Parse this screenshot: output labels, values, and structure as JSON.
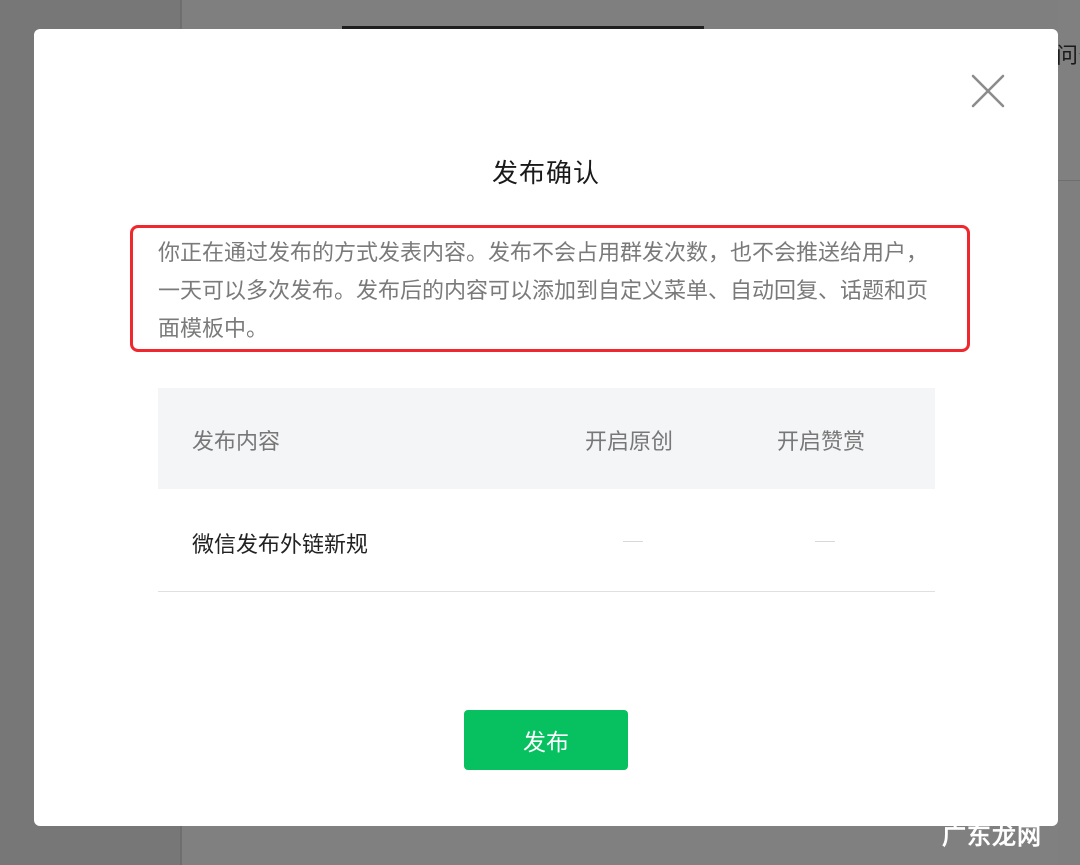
{
  "background": {
    "right_text": "问么"
  },
  "dialog": {
    "title": "发布确认",
    "description": "你正在通过发布的方式发表内容。发布不会占用群发次数，也不会推送给用户，一天可以多次发布。发布后的内容可以添加到自定义菜单、自动回复、话题和页面模板中。",
    "table": {
      "headers": {
        "content": "发布内容",
        "original": "开启原创",
        "reward": "开启赞赏"
      },
      "rows": [
        {
          "title": "微信发布外链新规",
          "original": "—",
          "reward": "—"
        }
      ]
    },
    "publish_label": "发布"
  },
  "watermark": "广东龙网",
  "colors": {
    "accent_green": "#07c160",
    "highlight_red": "#f0282d",
    "overlay_gray": "#7f7f7f"
  },
  "icons": {
    "close": "close-icon"
  }
}
